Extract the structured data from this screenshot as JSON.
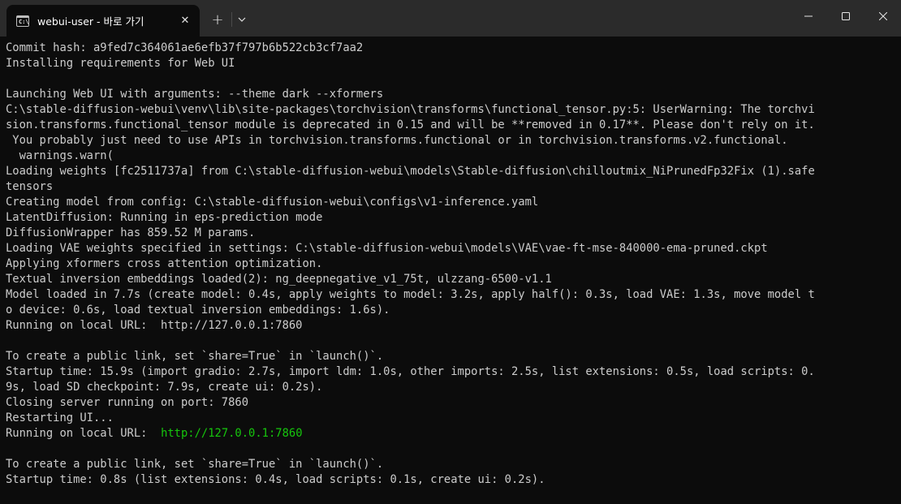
{
  "tab": {
    "icon": "terminal-icon",
    "icon_text": "C:\\",
    "title": "webui-user - 바로 가기",
    "close": "✕"
  },
  "titlebar": {
    "new_tab": "+",
    "icons": [
      "close-icon",
      "plus-icon",
      "chevron-down-icon",
      "minimize-icon",
      "maximize-icon",
      "close-icon"
    ]
  },
  "terminal": {
    "lines": [
      "Commit hash: a9fed7c364061ae6efb37f797b6b522cb3cf7aa2",
      "Installing requirements for Web UI",
      "",
      "Launching Web UI with arguments: --theme dark --xformers",
      "C:\\stable-diffusion-webui\\venv\\lib\\site-packages\\torchvision\\transforms\\functional_tensor.py:5: UserWarning: The torchvi",
      "sion.transforms.functional_tensor module is deprecated in 0.15 and will be **removed in 0.17**. Please don't rely on it.",
      " You probably just need to use APIs in torchvision.transforms.functional or in torchvision.transforms.v2.functional.",
      "  warnings.warn(",
      "Loading weights [fc2511737a] from C:\\stable-diffusion-webui\\models\\Stable-diffusion\\chilloutmix_NiPrunedFp32Fix (1).safe",
      "tensors",
      "Creating model from config: C:\\stable-diffusion-webui\\configs\\v1-inference.yaml",
      "LatentDiffusion: Running in eps-prediction mode",
      "DiffusionWrapper has 859.52 M params.",
      "Loading VAE weights specified in settings: C:\\stable-diffusion-webui\\models\\VAE\\vae-ft-mse-840000-ema-pruned.ckpt",
      "Applying xformers cross attention optimization.",
      "Textual inversion embeddings loaded(2): ng_deepnegative_v1_75t, ulzzang-6500-v1.1",
      "Model loaded in 7.7s (create model: 0.4s, apply weights to model: 3.2s, apply half(): 0.3s, load VAE: 1.3s, move model t",
      "o device: 0.6s, load textual inversion embeddings: 1.6s).",
      "Running on local URL:  http://127.0.0.1:7860",
      "",
      "To create a public link, set `share=True` in `launch()`.",
      "Startup time: 15.9s (import gradio: 2.7s, import ldm: 1.0s, other imports: 2.5s, list extensions: 0.5s, load scripts: 0.",
      "9s, load SD checkpoint: 7.9s, create ui: 0.2s).",
      "Closing server running on port: 7860",
      "Restarting UI...",
      "Running on local URL:  ",
      "",
      "To create a public link, set `share=True` in `launch()`.",
      "Startup time: 0.8s (list extensions: 0.4s, load scripts: 0.1s, create ui: 0.2s)."
    ],
    "highlight_url": "http://127.0.0.1:7860",
    "highlight_color": "#16c60c",
    "text_color": "#cccccc",
    "background": "#0c0c0c"
  }
}
